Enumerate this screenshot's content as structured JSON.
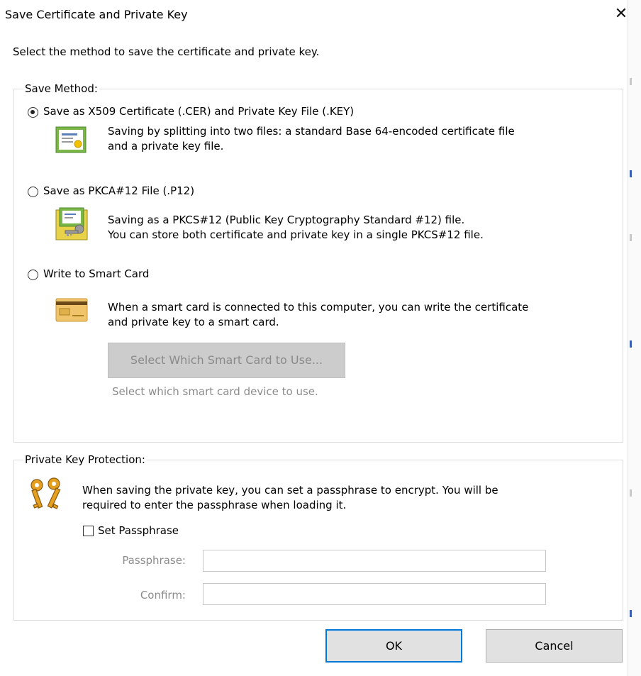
{
  "window": {
    "title": "Save Certificate and Private Key",
    "close_icon": "close-icon"
  },
  "intro_text": "Select the method to save the certificate and private key.",
  "save_method": {
    "legend": "Save Method:",
    "options": [
      {
        "label": "Save as X509 Certificate (.CER) and Private Key File (.KEY)",
        "selected": true,
        "icon": "certificate-icon",
        "desc_line1": "Saving by splitting into two files: a standard Base 64-encoded certificate file",
        "desc_line2": "and a private key file."
      },
      {
        "label": "Save as PKCA#12 File (.P12)",
        "selected": false,
        "icon": "pkcs12-certificate-key-icon",
        "desc_line1": "Saving as a PKCS#12 (Public Key Cryptography Standard #12) file.",
        "desc_line2": "You can store both certificate and private key in a single PKCS#12 file."
      },
      {
        "label": "Write to Smart Card",
        "selected": false,
        "icon": "smart-card-icon",
        "desc_line1": "When a smart card is connected to this computer, you can write the certificate",
        "desc_line2": "and private key to a smart card."
      }
    ],
    "select_card_button": "Select Which Smart Card to Use...",
    "select_card_hint": "Select which smart card device to use."
  },
  "private_key": {
    "legend": "Private Key Protection:",
    "icon": "keys-icon",
    "desc_line1": "When saving the private key, you can set a passphrase to encrypt. You will be",
    "desc_line2": "required to enter the passphrase when loading it.",
    "set_passphrase_label": "Set Passphrase",
    "set_passphrase_checked": false,
    "passphrase_label": "Passphrase:",
    "passphrase_value": "",
    "confirm_label": "Confirm:",
    "confirm_value": ""
  },
  "buttons": {
    "ok": "OK",
    "cancel": "Cancel"
  },
  "colors": {
    "accent": "#0078d7",
    "disabled_button": "#cccccc",
    "cert_green": "#7ab648"
  }
}
